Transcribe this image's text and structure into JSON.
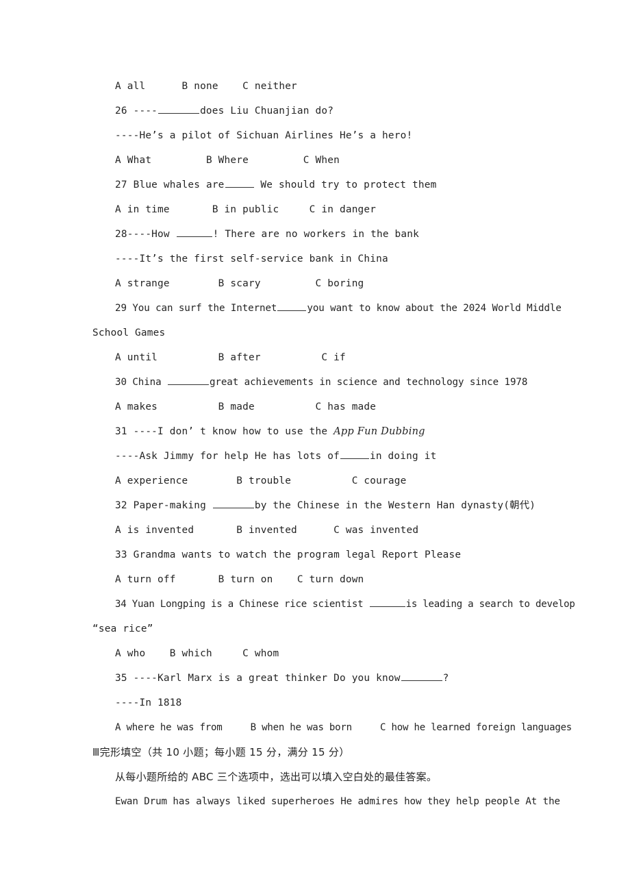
{
  "document": {
    "type": "exam-paper",
    "language": "en-zh",
    "page_background": "#ffffff",
    "text_color": "#242424"
  },
  "lines": {
    "l01_options_25": "A all      B none    C neither",
    "l02_q26_a": "26 ----",
    "l02_q26_b": "does Liu Chuanjian do?",
    "l03_q26_reply": "----He’s a pilot of Sichuan Airlines He’s a hero!",
    "l04_options_26": "A What         B Where         C When",
    "l05_q27_a": "27 Blue whales are",
    "l05_q27_b": " We should try to protect them",
    "l06_options_27": "A in time       B in public     C in danger",
    "l07_q28_a": "28----How ",
    "l07_q28_b": "! There are no workers in the bank",
    "l08_q28_reply": "----It’s the first self-service bank in China",
    "l09_options_28": "A strange        B scary         C boring",
    "l10_q29_a": "29 You can surf the Internet",
    "l10_q29_b": "you want to know about the 2024 World Middle",
    "l11_q29_wrap": "School Games",
    "l12_options_29": "A until          B after          C if",
    "l13_q30_a": "30 China ",
    "l13_q30_b": "great achievements in science and technology since 1978",
    "l14_options_30": "A makes          B made          C has made",
    "l15_q31_a": "31 ----I don’ t know how to use the ",
    "l15_q31_italic": "App Fun Dubbing",
    "l16_q31_reply_a": "----Ask Jimmy for help He has lots of",
    "l16_q31_reply_b": "in doing it",
    "l17_options_31": "A experience        B trouble          C courage",
    "l18_q32_a": "32 Paper-making ",
    "l18_q32_b": "by the Chinese in the Western Han dynasty(朝代)",
    "l19_options_32": "A is invented       B invented      C was invented",
    "l20_q33": "33 Grandma wants to watch the program legal Report Please",
    "l21_options_33": "A turn off       B turn on    C turn down",
    "l22_q34_a": "34 Yuan Longping is a Chinese rice scientist ",
    "l22_q34_b": "is leading a search to develop",
    "l23_q34_wrap": "“sea rice”",
    "l24_options_34": "A who    B which     C whom",
    "l25_q35_a": "35 ----Karl Marx is a great thinker Do you know",
    "l25_q35_b": "?",
    "l26_q35_reply": "----In 1818",
    "l27_options_35": "A where he was from     B when he was born     C how he learned foreign languages",
    "l28_section_heading": "Ⅲ完形填空（共 10 小题；每小题 15 分，满分 15 分）",
    "l29_instruction": "从每小题所给的 ABC 三个选项中，选出可以填入空白处的最佳答案。",
    "l30_passage_1": "Ewan Drum has always liked superheroes He admires how they help people At the"
  }
}
